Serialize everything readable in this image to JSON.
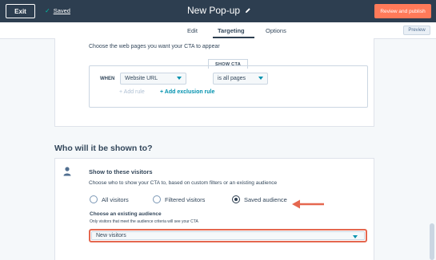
{
  "topbar": {
    "exit_label": "Exit",
    "saved_label": "Saved",
    "title": "New Pop-up",
    "publish_label": "Review and publish"
  },
  "tabs": {
    "edit": "Edit",
    "targeting": "Targeting",
    "options": "Options",
    "active": "Targeting",
    "preview_label": "Preview"
  },
  "pages_section": {
    "description": "Choose the web pages you want your CTA to appear",
    "show_cta_label": "SHOW CTA",
    "when_label": "WHEN",
    "url_dropdown": "Website URL",
    "condition_dropdown": "is all pages",
    "add_rule": "+ Add rule",
    "add_exclusion_rule": "+ Add exclusion rule"
  },
  "audience_section": {
    "heading": "Who will it be shown to?",
    "card_title": "Show to these visitors",
    "card_description": "Choose who to show your CTA to, based on custom filters or an existing audience",
    "radio_options": [
      "All visitors",
      "Filtered visitors",
      "Saved audience"
    ],
    "selected_radio": "Saved audience",
    "existing_label": "Choose an existing audience",
    "existing_note": "Only visitors that meet the audience criteria will see your CTA",
    "selected_audience": "New visitors"
  },
  "colors": {
    "topbar": "#2d3e50",
    "accent_orange": "#ff7a59",
    "highlight_red": "#e5674f",
    "link_teal": "#0091ae"
  }
}
